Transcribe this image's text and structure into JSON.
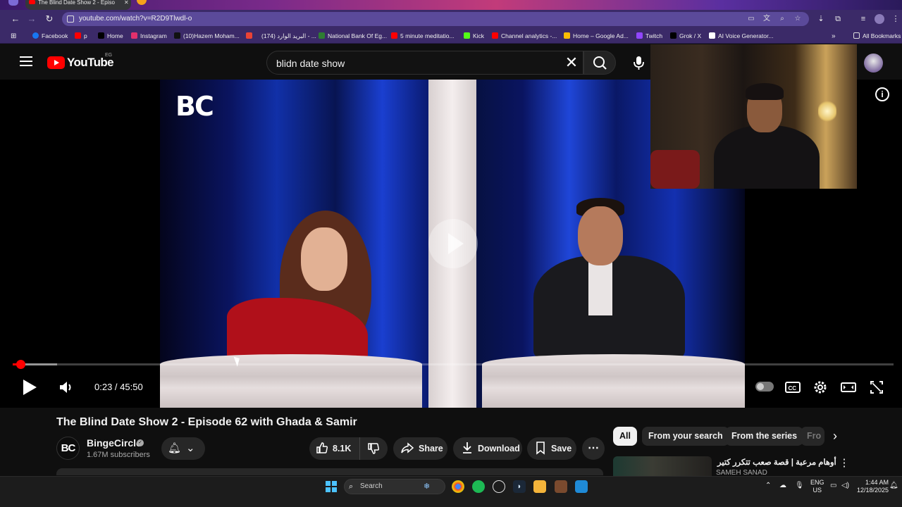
{
  "browser": {
    "tab_title": "The Blind Date Show 2 - Episo",
    "url": "youtube.com/watch?v=R2D9Tlwdl-o",
    "bookmarks": [
      {
        "label": "Facebook",
        "color": "#1877f2"
      },
      {
        "label": "p",
        "color": "#ff0000"
      },
      {
        "label": "Home",
        "color": "#000000"
      },
      {
        "label": "Instagram",
        "color": "#e1306c"
      },
      {
        "label": "(10)Hazem Moham...",
        "color": "#111111"
      },
      {
        "label": "",
        "color": "#ea4335"
      },
      {
        "label": "(174) البريد الوارد - ...",
        "color": "#1a73e8"
      },
      {
        "label": "National Bank Of Eg...",
        "color": "#2e7d32"
      },
      {
        "label": "5 minute meditatio...",
        "color": "#ff0000"
      },
      {
        "label": "Kick",
        "color": "#53fc18"
      },
      {
        "label": "Channel analytics -...",
        "color": "#ff0000"
      },
      {
        "label": "Home – Google Ad...",
        "color": "#fbbc04"
      },
      {
        "label": "Twitch",
        "color": "#9146ff"
      },
      {
        "label": "Grok / X",
        "color": "#000000"
      },
      {
        "label": "AI Voice Generator...",
        "color": "#ffffff"
      }
    ],
    "all_bookmarks": "All Bookmarks"
  },
  "masthead": {
    "logo_text": "YouTube",
    "country_code": "EG",
    "search_query": "blidn date show"
  },
  "player": {
    "channel_watermark": "BC",
    "current_time": "0:23",
    "duration": "45:50",
    "time_display": "0:23 / 45:50",
    "progress_fraction": 0.0084,
    "buffer_fraction": 0.05
  },
  "video": {
    "title": "The Blind Date Show 2 - Episode 62 with Ghada & Samir",
    "channel": {
      "avatar_text": "BC",
      "name": "BingeCircle",
      "subscribers": "1.67M subscribers"
    },
    "likes": "8.1K",
    "share_label": "Share",
    "download_label": "Download",
    "save_label": "Save"
  },
  "chips": [
    {
      "label": "All",
      "active": true
    },
    {
      "label": "From your search",
      "active": false
    },
    {
      "label": "From the series",
      "active": false
    },
    {
      "label": "Fro",
      "active": false
    }
  ],
  "recommendation": {
    "title": "أوهام مرعبة | قصة صعب تتكرر كتير",
    "channel": "SAMEH SANAD"
  },
  "taskbar": {
    "search_placeholder": "Search",
    "language": "ENG",
    "region": "US",
    "time": "1:44 AM",
    "date": "12/18/2025"
  }
}
